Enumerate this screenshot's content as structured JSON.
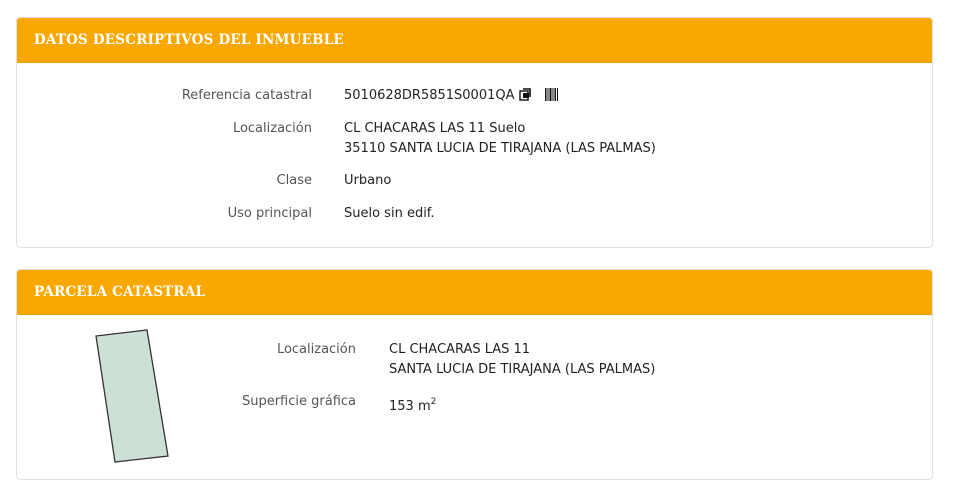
{
  "inmueble": {
    "title": "DATOS DESCRIPTIVOS DEL INMUEBLE",
    "fields": {
      "referencia_label": "Referencia catastral",
      "referencia_value": "5010628DR5851S0001QA",
      "localizacion_label": "Localización",
      "localizacion_line1": "CL CHACARAS LAS 11 Suelo",
      "localizacion_line2": "35110 SANTA LUCIA DE TIRAJANA (LAS PALMAS)",
      "clase_label": "Clase",
      "clase_value": "Urbano",
      "uso_label": "Uso principal",
      "uso_value": "Suelo sin edif."
    },
    "icons": [
      "copy-icon",
      "barcode-icon"
    ]
  },
  "parcela": {
    "title": "PARCELA CATASTRAL",
    "fields": {
      "localizacion_label": "Localización",
      "localizacion_line1": "CL CHACARAS LAS 11",
      "localizacion_line2": "SANTA LUCIA DE TIRAJANA (LAS PALMAS)",
      "superficie_label": "Superficie gráfica",
      "superficie_value": "153 m",
      "superficie_unit_sup": "2"
    },
    "sketch_fill": "#cde0d6",
    "sketch_stroke": "#333333"
  },
  "colors": {
    "header": "#f8a800",
    "header_text": "#ffffff"
  }
}
